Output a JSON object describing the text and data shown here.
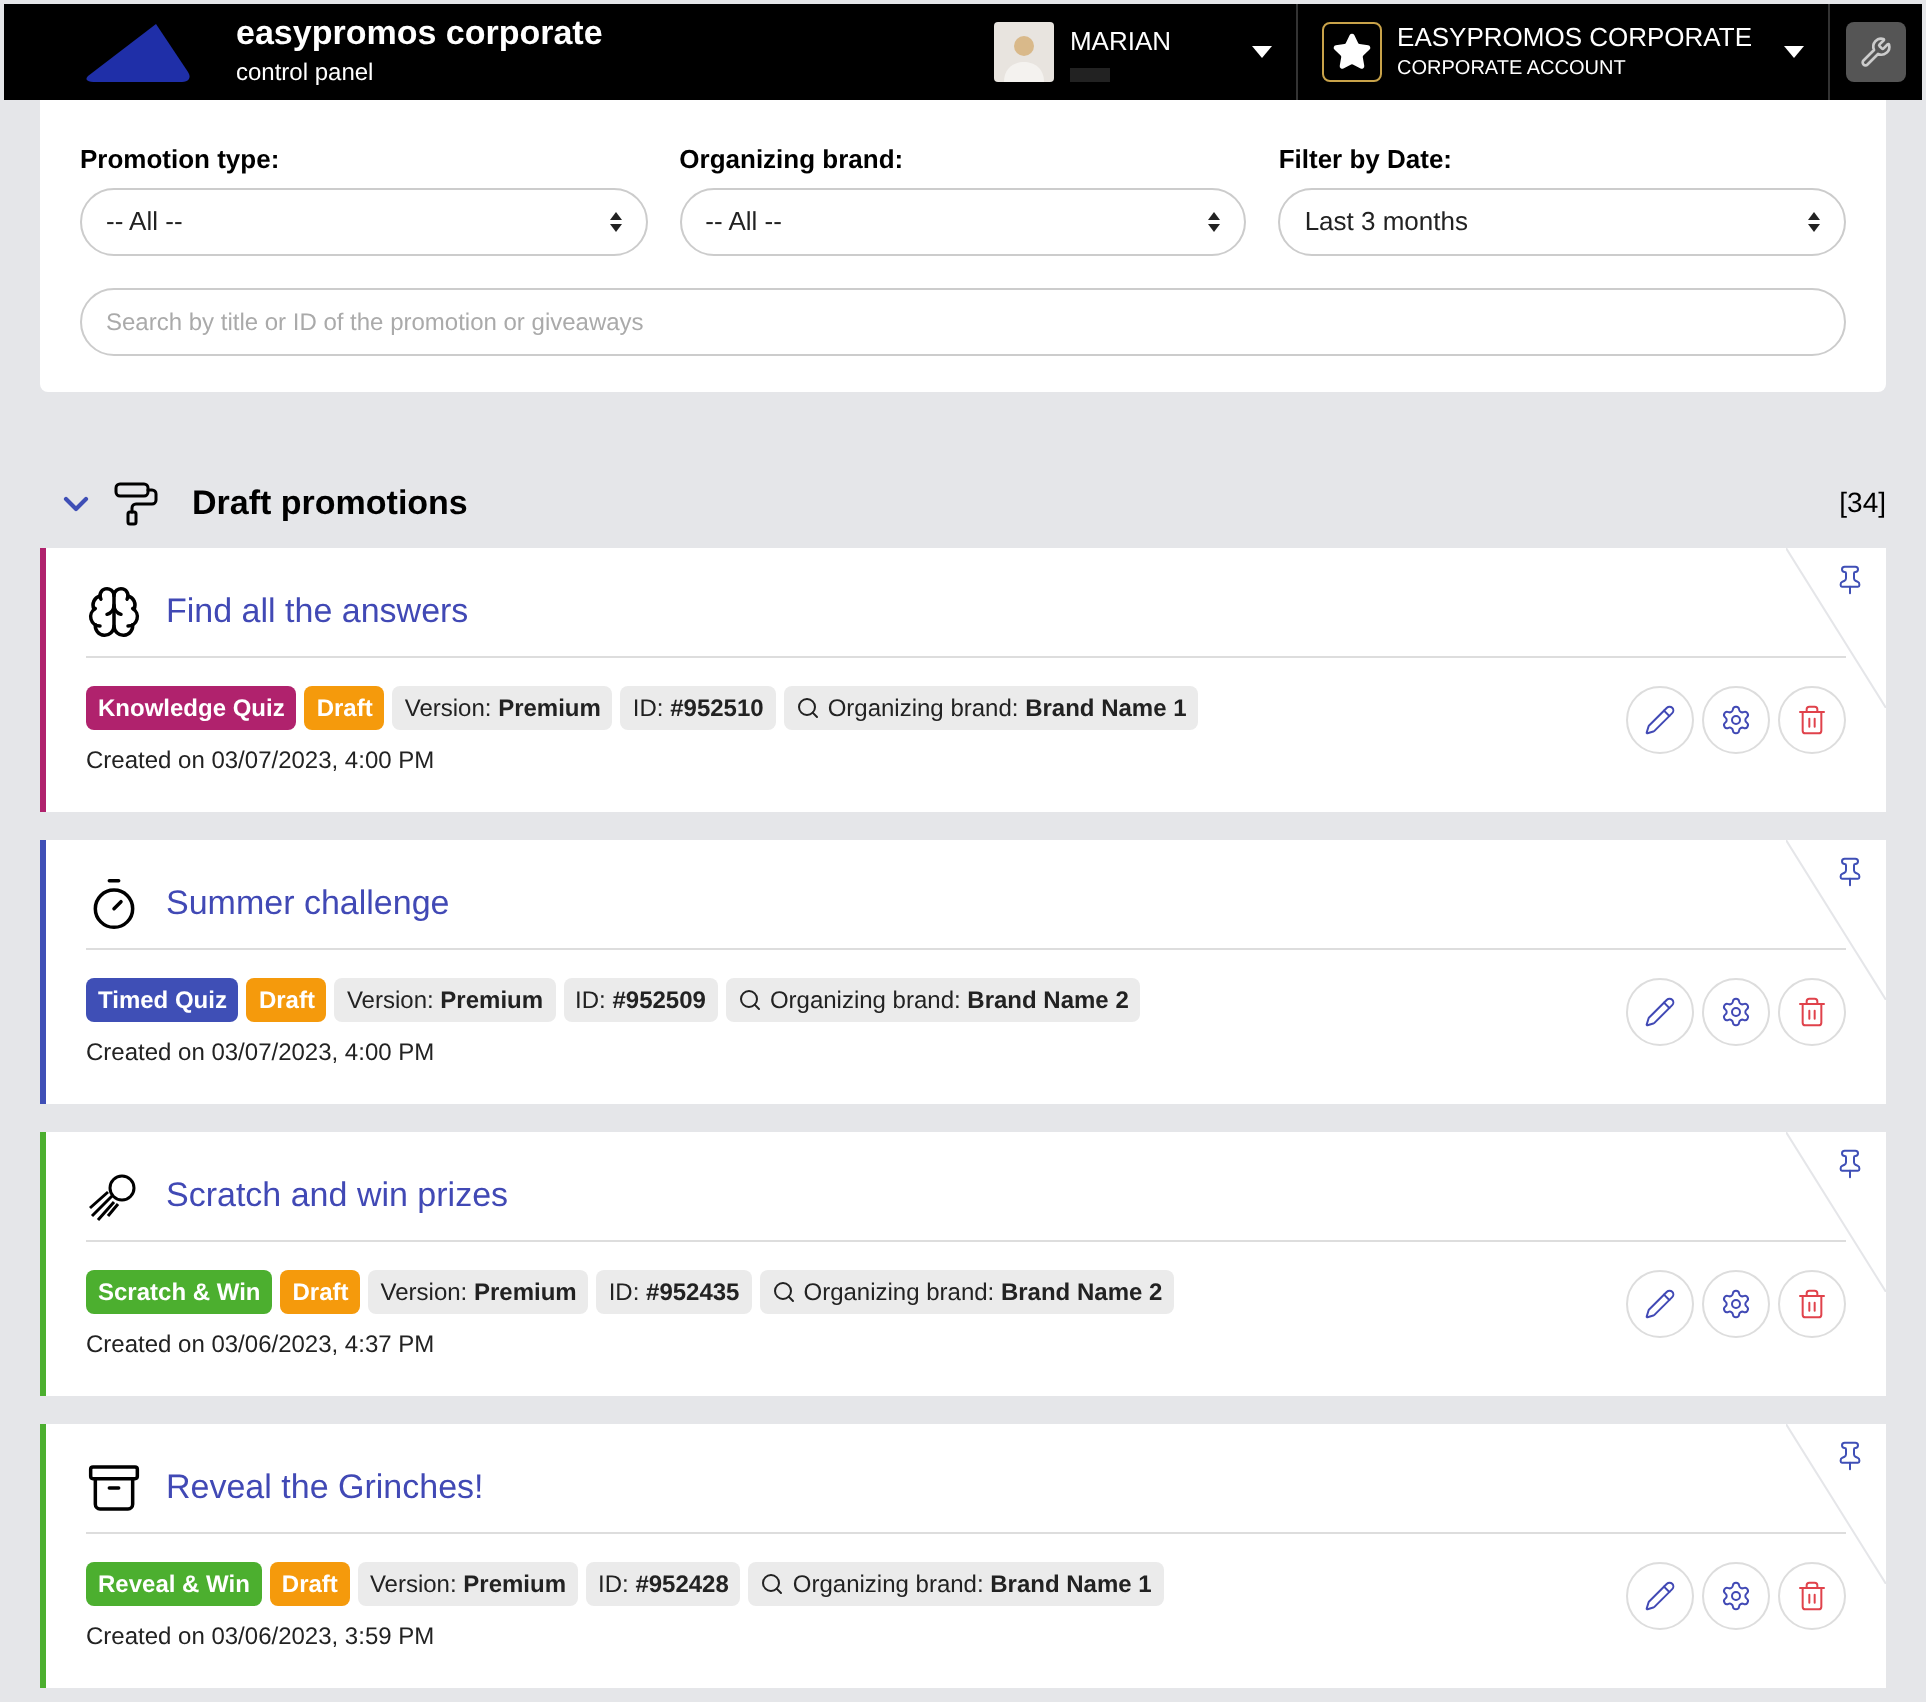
{
  "header": {
    "brand": "easypromos corporate",
    "subtitle": "control panel",
    "user": {
      "name": "MARIAN"
    },
    "account": {
      "name": "EASYPROMOS CORPORATE",
      "type": "CORPORATE ACCOUNT"
    }
  },
  "filters": [
    {
      "label": "Promotion type:",
      "value": "-- All --"
    },
    {
      "label": "Organizing brand:",
      "value": "-- All --"
    },
    {
      "label": "Filter by Date:",
      "value": "Last 3 months"
    }
  ],
  "search": {
    "placeholder": "Search by title or ID of the promotion or giveaways"
  },
  "section": {
    "title": "Draft promotions",
    "count": "[34]",
    "expanded": true
  },
  "promotions": [
    {
      "kind": "brain",
      "title": "Find all the answers",
      "type": "Knowledge Quiz",
      "color": "#b0226d",
      "status": "Draft",
      "version_label": "Version:",
      "version": "Premium",
      "id_label": "ID:",
      "id": "#952510",
      "brand_label": "Organizing brand:",
      "brand": "Brand Name 1",
      "created": "Created on 03/07/2023, 4:00 PM"
    },
    {
      "kind": "stopwatch",
      "title": "Summer challenge",
      "type": "Timed Quiz",
      "color": "#3f4fb6",
      "status": "Draft",
      "version_label": "Version:",
      "version": "Premium",
      "id_label": "ID:",
      "id": "#952509",
      "brand_label": "Organizing brand:",
      "brand": "Brand Name 2",
      "created": "Created on 03/07/2023, 4:00 PM"
    },
    {
      "kind": "comet",
      "title": "Scratch and win prizes",
      "type": "Scratch & Win",
      "color": "#4caf2f",
      "status": "Draft",
      "version_label": "Version:",
      "version": "Premium",
      "id_label": "ID:",
      "id": "#952435",
      "brand_label": "Organizing brand:",
      "brand": "Brand Name 2",
      "created": "Created on 03/06/2023, 4:37 PM"
    },
    {
      "kind": "chest",
      "title": "Reveal the Grinches!",
      "type": "Reveal & Win",
      "color": "#4caf2f",
      "status": "Draft",
      "version_label": "Version:",
      "version": "Premium",
      "id_label": "ID:",
      "id": "#952428",
      "brand_label": "Organizing brand:",
      "brand": "Brand Name 1",
      "created": "Created on 03/06/2023, 3:59 PM"
    }
  ]
}
